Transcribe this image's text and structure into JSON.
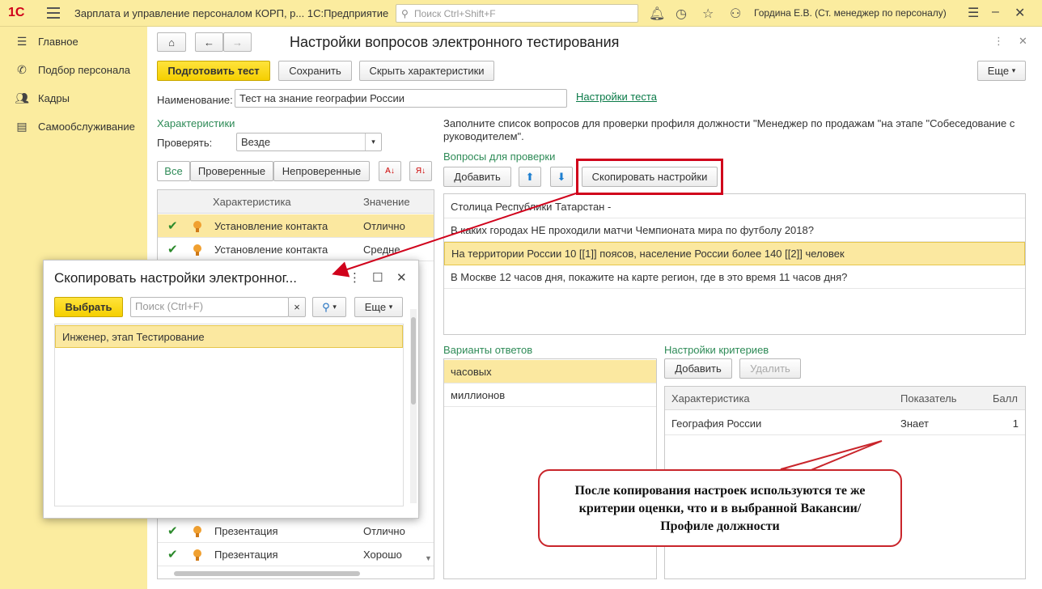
{
  "titlebar": {
    "logo": "1С",
    "app_title": "Зарплата и управление персоналом КОРП, р... 1С:Предприятие",
    "search_placeholder": "Поиск Ctrl+Shift+F",
    "user": "Гордина Е.В. (Ст. менеджер по персоналу)"
  },
  "sidebar": {
    "items": [
      {
        "label": "Главное",
        "icon": "menu-lines-icon"
      },
      {
        "label": "Подбор персонала",
        "icon": "phone-icon"
      },
      {
        "label": "Кадры",
        "icon": "people-icon"
      },
      {
        "label": "Самообслуживание",
        "icon": "list-icon"
      }
    ]
  },
  "form": {
    "title": "Настройки вопросов электронного тестирования",
    "prepare_button": "Подготовить тест",
    "save_button": "Сохранить",
    "hide_button": "Скрыть характеристики",
    "more_button": "Еще",
    "name_label": "Наименование:",
    "name_value": "Тест на знание географии России",
    "test_settings_link": "Настройки теста"
  },
  "characteristics": {
    "section_label": "Характеристики",
    "check_label": "Проверять:",
    "check_value": "Везде",
    "filter_all": "Все",
    "filter_checked": "Проверенные",
    "filter_unchecked": "Непроверенные",
    "col_characteristic": "Характеристика",
    "col_value": "Значение",
    "rows_top": [
      {
        "name": "Установление контакта",
        "value": "Отлично"
      },
      {
        "name": "Установление контакта",
        "value": "Средне"
      }
    ],
    "rows_bottom": [
      {
        "name": "Презентация",
        "value": "Отлично"
      },
      {
        "name": "Презентация",
        "value": "Хорошо"
      }
    ]
  },
  "questions": {
    "instruction": "Заполните список вопросов для проверки профиля должности \"Менеджер по продажам \"на этапе \"Собеседование с руководителем\".",
    "section_label": "Вопросы для проверки",
    "add_button": "Добавить",
    "copy_button": "Скопировать настройки",
    "items": [
      "Столица Республики Татарстан -",
      "В каких городах НЕ проходили матчи Чемпионата мира по футболу 2018?",
      "На территории России 10 [[1]] поясов, население России более 140 [[2]] человек",
      "В Москве 12 часов дня, покажите на карте регион, где в это время 11 часов дня?"
    ]
  },
  "answers": {
    "section_label": "Варианты ответов",
    "items": [
      "часовых",
      "миллионов"
    ]
  },
  "criteria": {
    "section_label": "Настройки критериев",
    "add_button": "Добавить",
    "delete_button": "Удалить",
    "col_characteristic": "Характеристика",
    "col_indicator": "Показатель",
    "col_score": "Балл",
    "rows": [
      {
        "characteristic": "География России",
        "indicator": "Знает",
        "score": "1"
      }
    ]
  },
  "popup": {
    "title": "Скопировать настройки электронног...",
    "select_button": "Выбрать",
    "search_placeholder": "Поиск (Ctrl+F)",
    "clear": "×",
    "more_button": "Еще",
    "items": [
      "Инженер, этап Тестирование"
    ]
  },
  "annotation": {
    "callout": "После копирования настроек используются те же критерии оценки, что и в выбранной Вакансии/Профиле должности"
  },
  "colors": {
    "accent_yellow": "#fbec9f",
    "highlight_row": "#fbe8a0",
    "primary_button": "#f5cf00",
    "annotation_red": "#d0021b",
    "section_green": "#2e8b57"
  }
}
